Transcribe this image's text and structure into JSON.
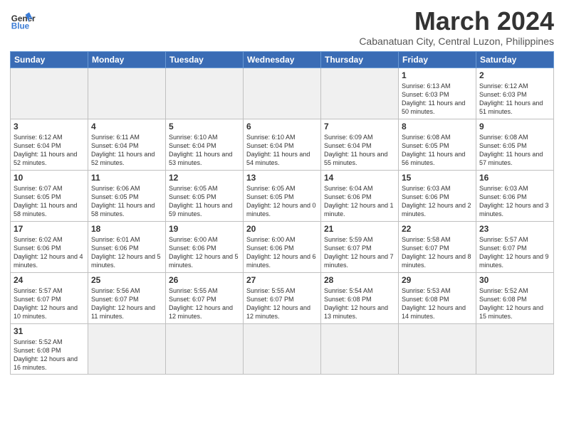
{
  "header": {
    "logo_general": "General",
    "logo_blue": "Blue",
    "month_title": "March 2024",
    "subtitle": "Cabanatuan City, Central Luzon, Philippines"
  },
  "weekdays": [
    "Sunday",
    "Monday",
    "Tuesday",
    "Wednesday",
    "Thursday",
    "Friday",
    "Saturday"
  ],
  "weeks": [
    [
      {
        "day": "",
        "info": ""
      },
      {
        "day": "",
        "info": ""
      },
      {
        "day": "",
        "info": ""
      },
      {
        "day": "",
        "info": ""
      },
      {
        "day": "",
        "info": ""
      },
      {
        "day": "1",
        "info": "Sunrise: 6:13 AM\nSunset: 6:03 PM\nDaylight: 11 hours and 50 minutes."
      },
      {
        "day": "2",
        "info": "Sunrise: 6:12 AM\nSunset: 6:03 PM\nDaylight: 11 hours and 51 minutes."
      }
    ],
    [
      {
        "day": "3",
        "info": "Sunrise: 6:12 AM\nSunset: 6:04 PM\nDaylight: 11 hours and 52 minutes."
      },
      {
        "day": "4",
        "info": "Sunrise: 6:11 AM\nSunset: 6:04 PM\nDaylight: 11 hours and 52 minutes."
      },
      {
        "day": "5",
        "info": "Sunrise: 6:10 AM\nSunset: 6:04 PM\nDaylight: 11 hours and 53 minutes."
      },
      {
        "day": "6",
        "info": "Sunrise: 6:10 AM\nSunset: 6:04 PM\nDaylight: 11 hours and 54 minutes."
      },
      {
        "day": "7",
        "info": "Sunrise: 6:09 AM\nSunset: 6:04 PM\nDaylight: 11 hours and 55 minutes."
      },
      {
        "day": "8",
        "info": "Sunrise: 6:08 AM\nSunset: 6:05 PM\nDaylight: 11 hours and 56 minutes."
      },
      {
        "day": "9",
        "info": "Sunrise: 6:08 AM\nSunset: 6:05 PM\nDaylight: 11 hours and 57 minutes."
      }
    ],
    [
      {
        "day": "10",
        "info": "Sunrise: 6:07 AM\nSunset: 6:05 PM\nDaylight: 11 hours and 58 minutes."
      },
      {
        "day": "11",
        "info": "Sunrise: 6:06 AM\nSunset: 6:05 PM\nDaylight: 11 hours and 58 minutes."
      },
      {
        "day": "12",
        "info": "Sunrise: 6:05 AM\nSunset: 6:05 PM\nDaylight: 11 hours and 59 minutes."
      },
      {
        "day": "13",
        "info": "Sunrise: 6:05 AM\nSunset: 6:05 PM\nDaylight: 12 hours and 0 minutes."
      },
      {
        "day": "14",
        "info": "Sunrise: 6:04 AM\nSunset: 6:06 PM\nDaylight: 12 hours and 1 minute."
      },
      {
        "day": "15",
        "info": "Sunrise: 6:03 AM\nSunset: 6:06 PM\nDaylight: 12 hours and 2 minutes."
      },
      {
        "day": "16",
        "info": "Sunrise: 6:03 AM\nSunset: 6:06 PM\nDaylight: 12 hours and 3 minutes."
      }
    ],
    [
      {
        "day": "17",
        "info": "Sunrise: 6:02 AM\nSunset: 6:06 PM\nDaylight: 12 hours and 4 minutes."
      },
      {
        "day": "18",
        "info": "Sunrise: 6:01 AM\nSunset: 6:06 PM\nDaylight: 12 hours and 5 minutes."
      },
      {
        "day": "19",
        "info": "Sunrise: 6:00 AM\nSunset: 6:06 PM\nDaylight: 12 hours and 5 minutes."
      },
      {
        "day": "20",
        "info": "Sunrise: 6:00 AM\nSunset: 6:06 PM\nDaylight: 12 hours and 6 minutes."
      },
      {
        "day": "21",
        "info": "Sunrise: 5:59 AM\nSunset: 6:07 PM\nDaylight: 12 hours and 7 minutes."
      },
      {
        "day": "22",
        "info": "Sunrise: 5:58 AM\nSunset: 6:07 PM\nDaylight: 12 hours and 8 minutes."
      },
      {
        "day": "23",
        "info": "Sunrise: 5:57 AM\nSunset: 6:07 PM\nDaylight: 12 hours and 9 minutes."
      }
    ],
    [
      {
        "day": "24",
        "info": "Sunrise: 5:57 AM\nSunset: 6:07 PM\nDaylight: 12 hours and 10 minutes."
      },
      {
        "day": "25",
        "info": "Sunrise: 5:56 AM\nSunset: 6:07 PM\nDaylight: 12 hours and 11 minutes."
      },
      {
        "day": "26",
        "info": "Sunrise: 5:55 AM\nSunset: 6:07 PM\nDaylight: 12 hours and 12 minutes."
      },
      {
        "day": "27",
        "info": "Sunrise: 5:55 AM\nSunset: 6:07 PM\nDaylight: 12 hours and 12 minutes."
      },
      {
        "day": "28",
        "info": "Sunrise: 5:54 AM\nSunset: 6:08 PM\nDaylight: 12 hours and 13 minutes."
      },
      {
        "day": "29",
        "info": "Sunrise: 5:53 AM\nSunset: 6:08 PM\nDaylight: 12 hours and 14 minutes."
      },
      {
        "day": "30",
        "info": "Sunrise: 5:52 AM\nSunset: 6:08 PM\nDaylight: 12 hours and 15 minutes."
      }
    ],
    [
      {
        "day": "31",
        "info": "Sunrise: 5:52 AM\nSunset: 6:08 PM\nDaylight: 12 hours and 16 minutes."
      },
      {
        "day": "",
        "info": ""
      },
      {
        "day": "",
        "info": ""
      },
      {
        "day": "",
        "info": ""
      },
      {
        "day": "",
        "info": ""
      },
      {
        "day": "",
        "info": ""
      },
      {
        "day": "",
        "info": ""
      }
    ]
  ]
}
